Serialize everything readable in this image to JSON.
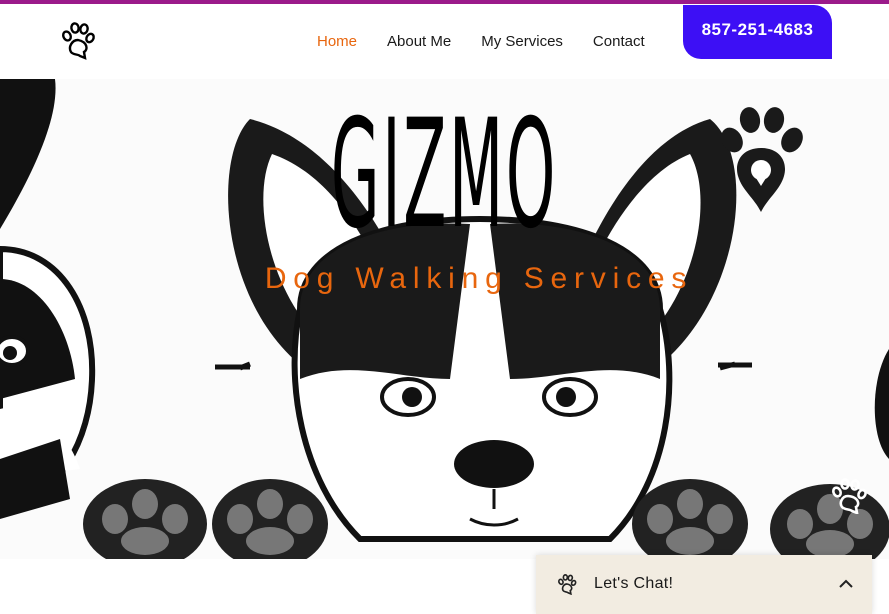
{
  "header": {
    "logo_icon": "paw-print-icon",
    "nav": [
      {
        "label": "Home",
        "active": true
      },
      {
        "label": "About Me",
        "active": false
      },
      {
        "label": "My Services",
        "active": false
      },
      {
        "label": "Contact",
        "active": false
      }
    ],
    "phone": "857-251-4683"
  },
  "social": [
    {
      "icon": "facebook-icon"
    },
    {
      "icon": "youtube-icon"
    },
    {
      "icon": "yelp-icon"
    },
    {
      "icon": "instagram-icon"
    }
  ],
  "hero": {
    "title": "GIZMO",
    "subtitle": "Dog Walking Services",
    "background": "french-bulldog-illustration"
  },
  "chat": {
    "label": "Let's Chat!",
    "icon": "paw-print-icon",
    "toggle_icon": "chevron-up-icon"
  },
  "colors": {
    "accent_orange": "#e8660e",
    "phone_button": "#3d0ff5",
    "top_stripe": "#9b1a8a",
    "chat_bg": "#f2ece1"
  }
}
